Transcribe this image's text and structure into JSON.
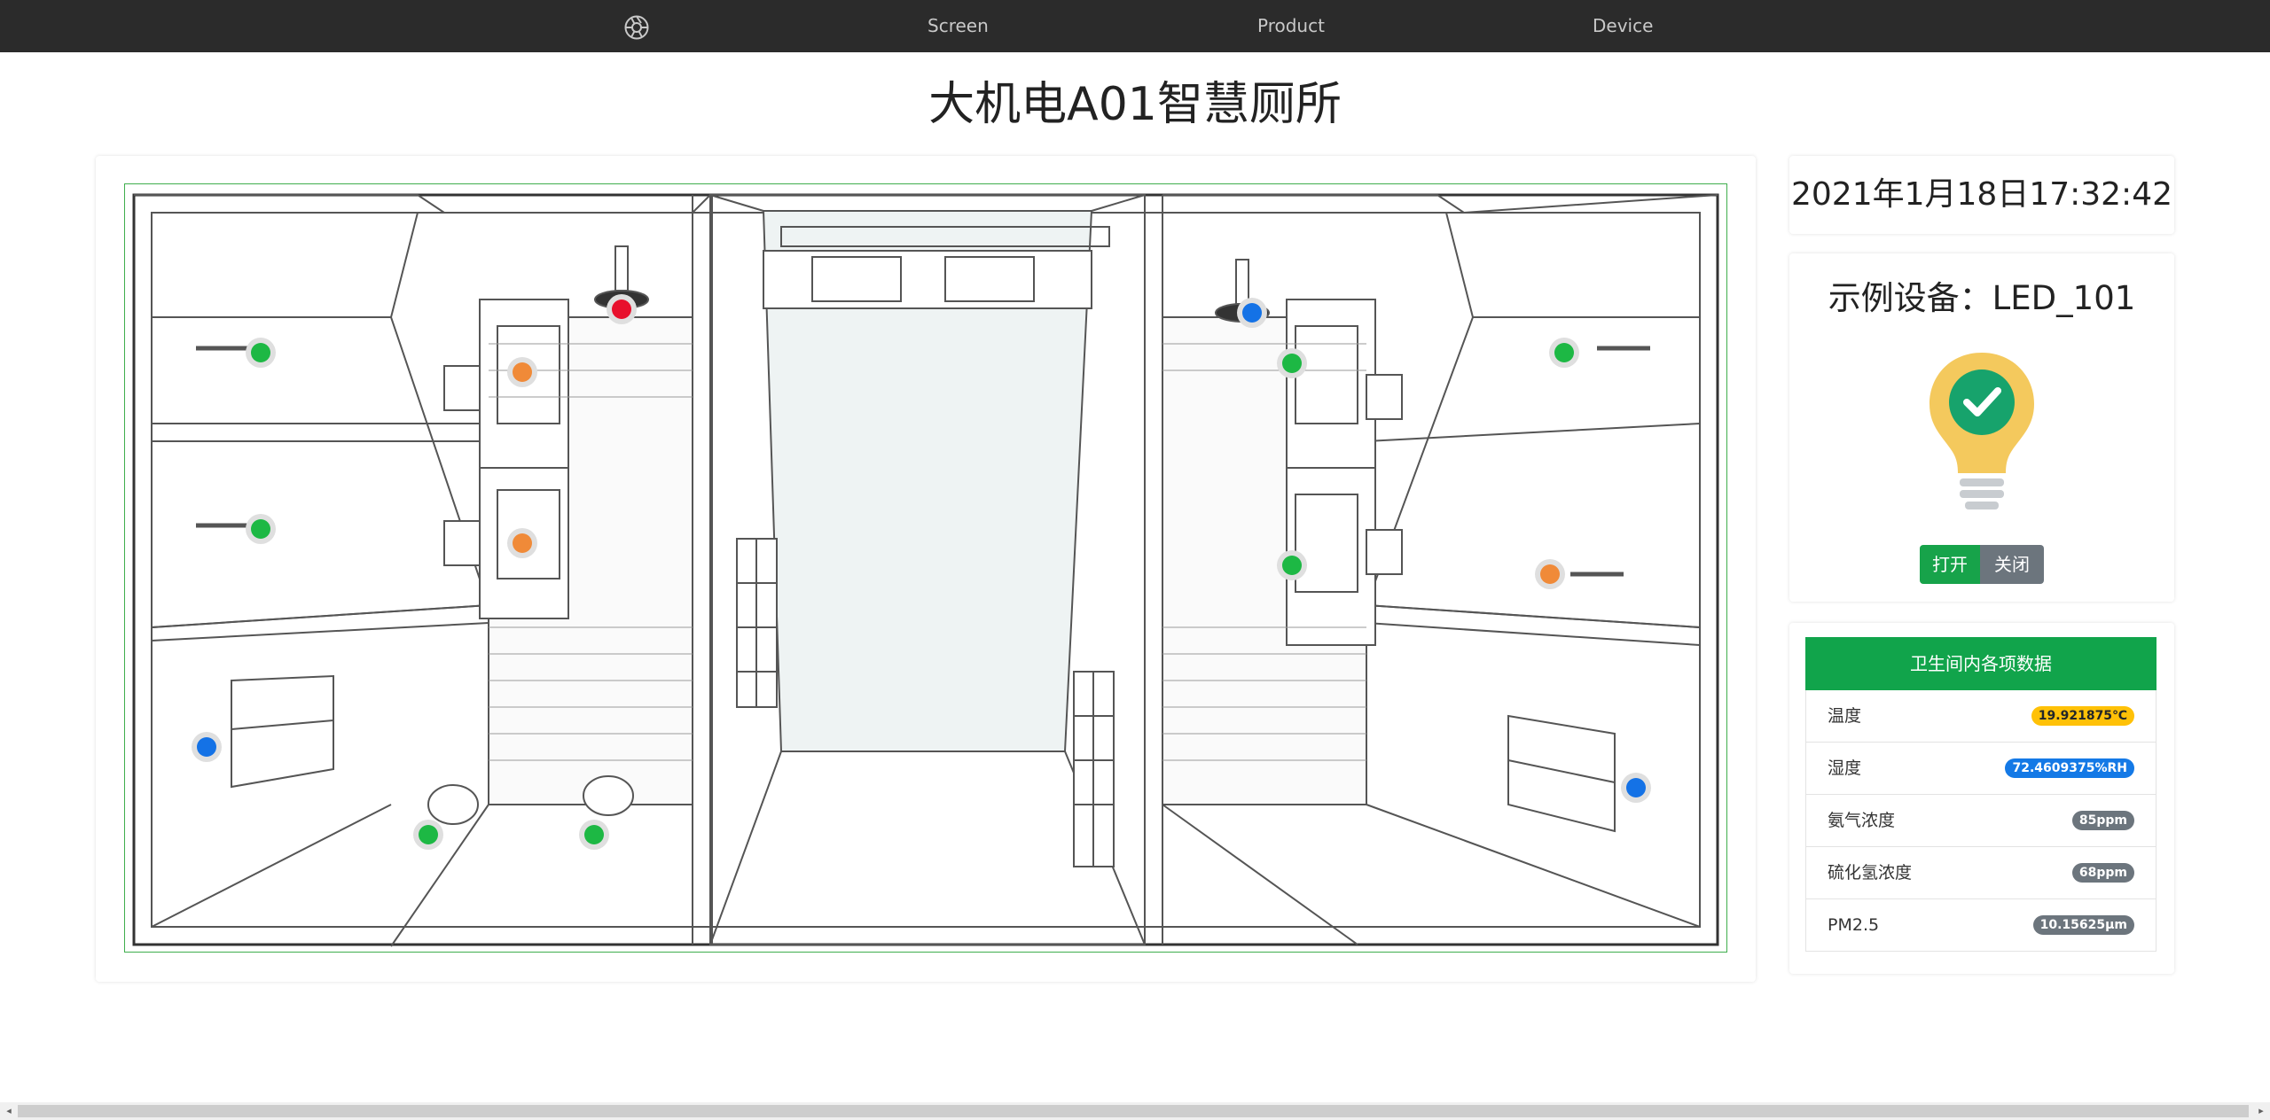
{
  "nav": {
    "logo_icon": "aperture-icon",
    "links": [
      "Screen",
      "Product",
      "Device"
    ]
  },
  "page": {
    "title": "大机电A01智慧厕所"
  },
  "floorplan": {
    "sensors": [
      {
        "name": "sensor-left-stall-1-door",
        "color": "#1db844"
      },
      {
        "name": "sensor-left-stall-1-toilet",
        "color": "#f08a38"
      },
      {
        "name": "sensor-left-stall-2-door",
        "color": "#1db844"
      },
      {
        "name": "sensor-left-stall-2-toilet",
        "color": "#f08a38"
      },
      {
        "name": "sensor-left-ceiling-camera",
        "color": "#e8102c"
      },
      {
        "name": "sensor-left-window",
        "color": "#1472e6"
      },
      {
        "name": "sensor-left-urinal-1",
        "color": "#1db844"
      },
      {
        "name": "sensor-left-urinal-2",
        "color": "#1db844"
      },
      {
        "name": "sensor-right-ceiling-camera",
        "color": "#1472e6"
      },
      {
        "name": "sensor-right-stall-1-toilet",
        "color": "#1db844"
      },
      {
        "name": "sensor-right-stall-1-door",
        "color": "#1db844"
      },
      {
        "name": "sensor-right-stall-2-toilet",
        "color": "#1db844"
      },
      {
        "name": "sensor-right-stall-2-door",
        "color": "#f08a38"
      },
      {
        "name": "sensor-right-window",
        "color": "#1472e6"
      }
    ]
  },
  "datetime": "2021年1月18日17:32:42",
  "device": {
    "title": "示例设备：LED_101",
    "icon": "lightbulb-check-icon",
    "on_label": "打开",
    "off_label": "关闭"
  },
  "env_table": {
    "header": "卫生间内各项数据",
    "rows": [
      {
        "label": "温度",
        "value": "19.921875℃",
        "badge_bg": "#ffc107",
        "badge_fg": "#212529"
      },
      {
        "label": "湿度",
        "value": "72.4609375%RH",
        "badge_bg": "#1479e6",
        "badge_fg": "#ffffff"
      },
      {
        "label": "氨气浓度",
        "value": "85ppm",
        "badge_bg": "#6c757d",
        "badge_fg": "#ffffff"
      },
      {
        "label": "硫化氢浓度",
        "value": "68ppm",
        "badge_bg": "#6c757d",
        "badge_fg": "#ffffff"
      },
      {
        "label": "PM2.5",
        "value": "10.15625μm",
        "badge_bg": "#6c757d",
        "badge_fg": "#ffffff"
      }
    ]
  }
}
